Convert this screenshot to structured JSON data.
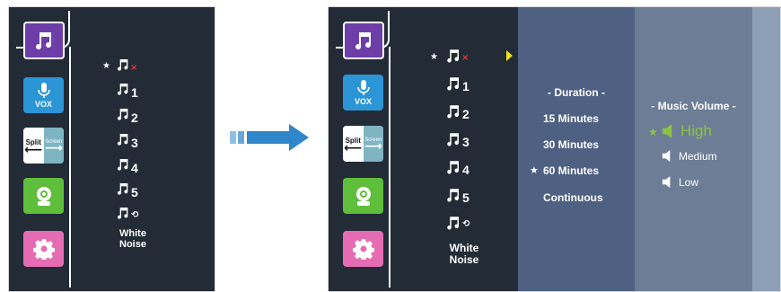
{
  "left_screen": {
    "apps": [
      {
        "name": "music",
        "label": ""
      },
      {
        "name": "vox",
        "label": "VOX"
      },
      {
        "name": "split-screen",
        "label_a": "Split",
        "label_b": "Screen"
      },
      {
        "name": "camera",
        "label": ""
      },
      {
        "name": "settings",
        "label": ""
      }
    ],
    "tracks": [
      "",
      "1",
      "2",
      "3",
      "4",
      "5",
      ""
    ],
    "white_noise": "White Noise"
  },
  "right_screen": {
    "apps": [
      {
        "name": "music",
        "label": ""
      },
      {
        "name": "vox",
        "label": "VOX"
      },
      {
        "name": "split-screen",
        "label_a": "Split",
        "label_b": "Screen"
      },
      {
        "name": "camera",
        "label": ""
      },
      {
        "name": "settings",
        "label": ""
      }
    ],
    "tracks": [
      "",
      "1",
      "2",
      "3",
      "4",
      "5",
      ""
    ],
    "white_noise": "White Noise",
    "duration": {
      "title": "- Duration -",
      "options": [
        "15 Minutes",
        "30 Minutes",
        "60 Minutes",
        "Continuous"
      ],
      "selected": "60 Minutes"
    },
    "music_volume": {
      "title": "- Music Volume -",
      "options": [
        "High",
        "Medium",
        "Low"
      ],
      "selected": "High"
    }
  },
  "colors": {
    "screen_bg": "#222b36",
    "music_app": "#6e3ea8",
    "vox_app": "#2b95d6",
    "camera_app": "#5fbf3c",
    "settings_app": "#e56cb3",
    "duration_panel": "#4e6183",
    "volume_panel": "#6c7d95",
    "selected_green": "#8cc63f",
    "pointer_yellow": "#f2e21b",
    "transition_arrow": "#2f86c9"
  },
  "icons": {
    "track": "music-note-icon",
    "muted": "mute-x-icon",
    "loop": "loop-icon",
    "speaker": "speaker-icon",
    "star": "star-icon"
  }
}
